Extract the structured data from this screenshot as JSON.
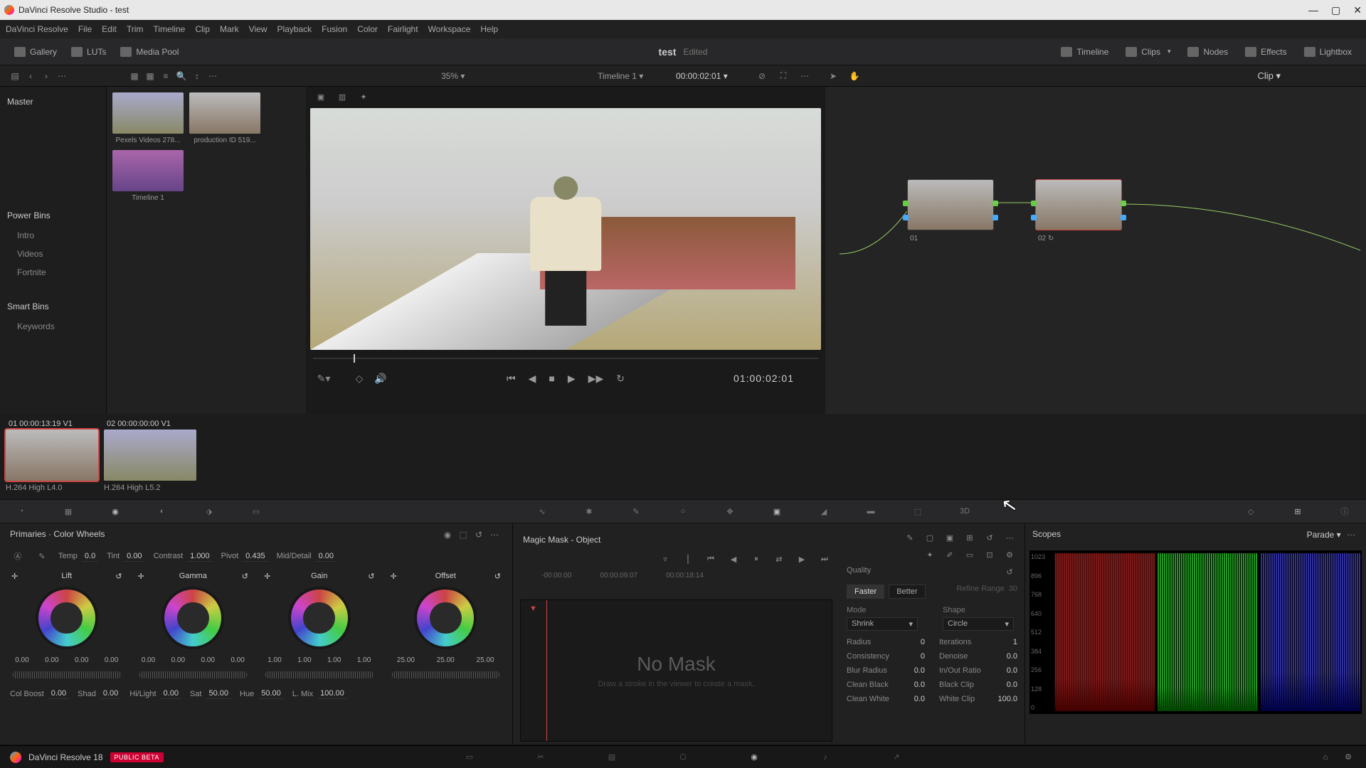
{
  "title": "DaVinci Resolve Studio - test",
  "menu": [
    "DaVinci Resolve",
    "File",
    "Edit",
    "Trim",
    "Timeline",
    "Clip",
    "Mark",
    "View",
    "Playback",
    "Fusion",
    "Color",
    "Fairlight",
    "Workspace",
    "Help"
  ],
  "toolbar_left": [
    {
      "label": "Gallery"
    },
    {
      "label": "LUTs"
    },
    {
      "label": "Media Pool"
    }
  ],
  "project": {
    "name": "test",
    "status": "Edited"
  },
  "toolbar_right": [
    {
      "label": "Timeline"
    },
    {
      "label": "Clips"
    },
    {
      "label": "Nodes"
    },
    {
      "label": "Effects"
    },
    {
      "label": "Lightbox"
    }
  ],
  "row2": {
    "zoom": "35%",
    "timeline": "Timeline 1",
    "tc": "00:00:02:01",
    "clip": "Clip"
  },
  "sidebar": {
    "master": "Master",
    "powerbins": "Power Bins",
    "pbitems": [
      "Intro",
      "Videos",
      "Fortnite"
    ],
    "smartbins": "Smart Bins",
    "sbitems": [
      "Keywords"
    ]
  },
  "thumbs": [
    {
      "label": "Pexels Videos 278..."
    },
    {
      "label": "production ID 519..."
    },
    {
      "label": "Timeline 1"
    }
  ],
  "viewer": {
    "tc": "01:00:02:01"
  },
  "nodes": [
    {
      "id": "01",
      "sel": false
    },
    {
      "id": "02",
      "sel": true
    }
  ],
  "clips": [
    {
      "hdr": "01   00:00:13:19   V1",
      "codec": "H.264 High L4.0",
      "sel": true
    },
    {
      "hdr": "02   00:00:00:00   V1",
      "codec": "H.264 High L5.2",
      "sel": false
    }
  ],
  "primaries": {
    "title": "Primaries · Color Wheels",
    "adjust": [
      {
        "k": "Temp",
        "v": "0.0"
      },
      {
        "k": "Tint",
        "v": "0.00"
      },
      {
        "k": "Contrast",
        "v": "1.000"
      },
      {
        "k": "Pivot",
        "v": "0.435"
      },
      {
        "k": "Mid/Detail",
        "v": "0.00"
      }
    ],
    "wheels": [
      {
        "name": "Lift",
        "vals": [
          "0.00",
          "0.00",
          "0.00",
          "0.00"
        ]
      },
      {
        "name": "Gamma",
        "vals": [
          "0.00",
          "0.00",
          "0.00",
          "0.00"
        ]
      },
      {
        "name": "Gain",
        "vals": [
          "1.00",
          "1.00",
          "1.00",
          "1.00"
        ]
      },
      {
        "name": "Offset",
        "vals": [
          "25.00",
          "25.00",
          "25.00"
        ]
      }
    ],
    "bottom": [
      {
        "k": "Col Boost",
        "v": "0.00"
      },
      {
        "k": "Shad",
        "v": "0.00"
      },
      {
        "k": "Hi/Light",
        "v": "0.00"
      },
      {
        "k": "Sat",
        "v": "50.00"
      },
      {
        "k": "Hue",
        "v": "50.00"
      },
      {
        "k": "L. Mix",
        "v": "100.00"
      }
    ]
  },
  "mask": {
    "title": "Magic Mask - Object",
    "tcs": [
      "-00:00:00",
      "00:00:09:07",
      "00:00:18:14"
    ],
    "nomask": "No Mask",
    "nomask2": "Draw a stroke in the viewer to create a mask.",
    "quality_lbl": "Quality",
    "faster": "Faster",
    "better": "Better",
    "refine": "Refine Range",
    "refine_v": "30",
    "mode_lbl": "Mode",
    "mode_v": "Shrink",
    "shape_lbl": "Shape",
    "shape_v": "Circle",
    "params": [
      {
        "k": "Radius",
        "v": "0"
      },
      {
        "k": "Iterations",
        "v": "1"
      },
      {
        "k": "Consistency",
        "v": "0"
      },
      {
        "k": "Denoise",
        "v": "0.0"
      },
      {
        "k": "Blur Radius",
        "v": "0.0"
      },
      {
        "k": "In/Out Ratio",
        "v": "0.0"
      },
      {
        "k": "Clean Black",
        "v": "0.0"
      },
      {
        "k": "Black Clip",
        "v": "0.0"
      },
      {
        "k": "Clean White",
        "v": "0.0"
      },
      {
        "k": "White Clip",
        "v": "100.0"
      }
    ]
  },
  "scopes": {
    "title": "Scopes",
    "mode": "Parade",
    "ticks": [
      "1023",
      "896",
      "768",
      "640",
      "512",
      "384",
      "256",
      "128",
      "0"
    ]
  },
  "footer": {
    "app": "DaVinci Resolve 18",
    "badge": "PUBLIC BETA"
  }
}
